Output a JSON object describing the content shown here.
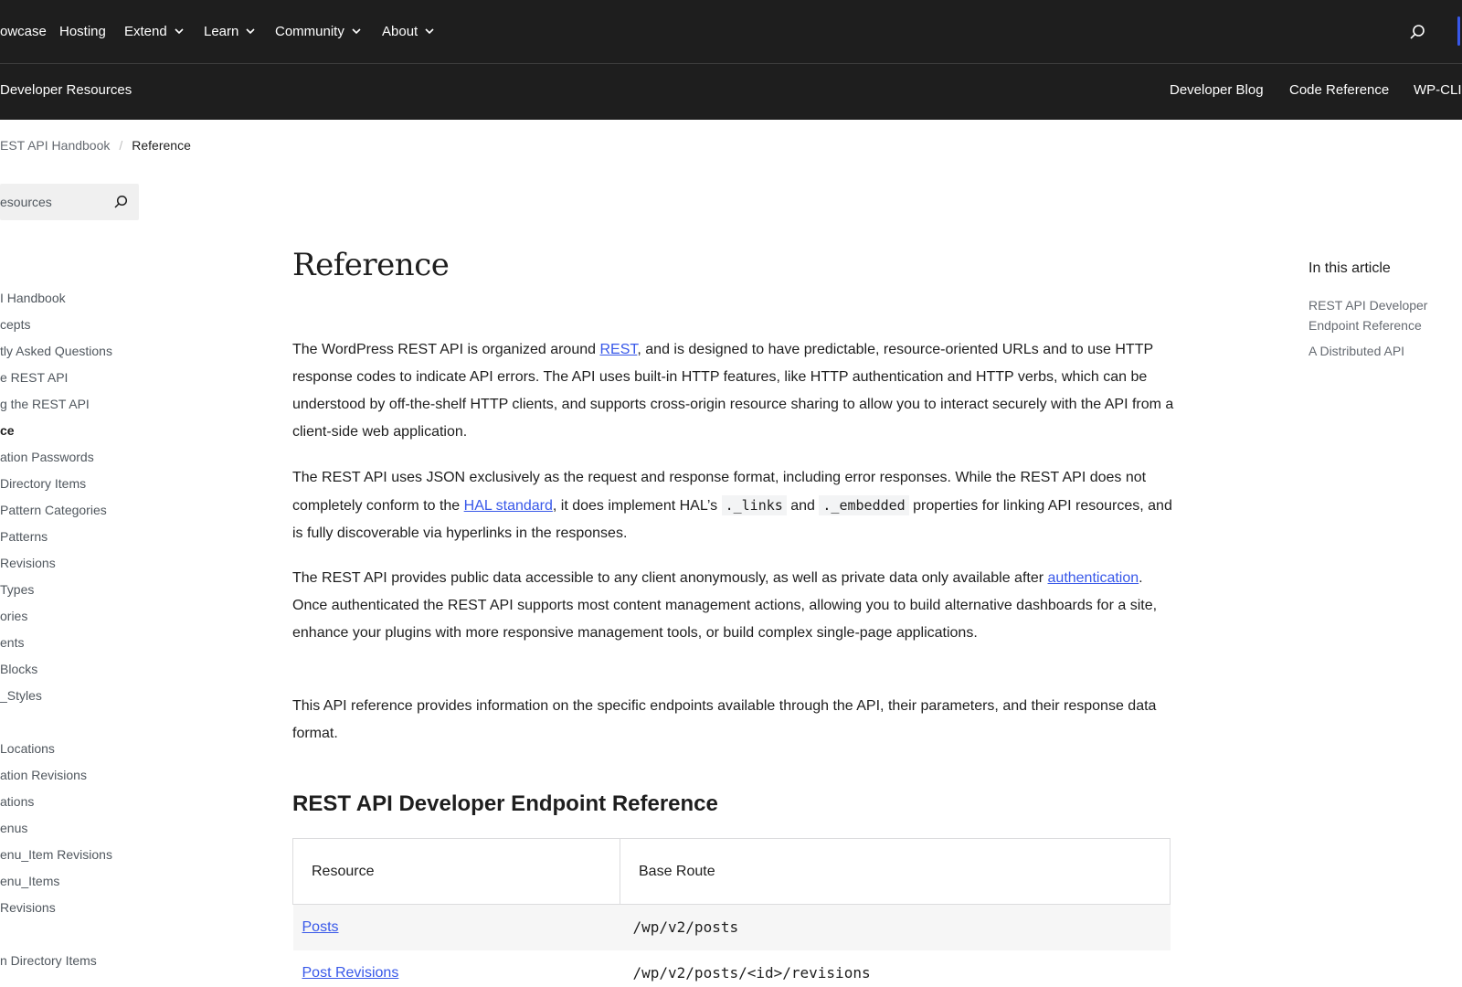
{
  "global_nav": {
    "items": [
      {
        "label": "owcase",
        "has_menu": false
      },
      {
        "label": "Hosting",
        "has_menu": false
      },
      {
        "label": "Extend",
        "has_menu": true
      },
      {
        "label": "Learn",
        "has_menu": true
      },
      {
        "label": "Community",
        "has_menu": true
      },
      {
        "label": "About",
        "has_menu": true
      }
    ]
  },
  "local_nav": {
    "title": "Developer Resources",
    "links": [
      "Developer Blog",
      "Code Reference",
      "WP-CLI"
    ]
  },
  "breadcrumb": {
    "parent": "EST API Handbook",
    "separator": "/",
    "current": "Reference"
  },
  "sidebar": {
    "search_placeholder": "esources",
    "items": [
      "I Handbook",
      "cepts",
      "tly Asked Questions",
      "e REST API",
      "g the REST API",
      "ce",
      "ation Passwords",
      "Directory Items",
      "Pattern Categories",
      "Patterns",
      "Revisions",
      "Types",
      "ories",
      "ents",
      "Blocks",
      "_Styles",
      "Locations",
      "ation Revisions",
      "ations",
      "enus",
      "enu_Item Revisions",
      "enu_Items",
      "Revisions",
      "n Directory Items"
    ]
  },
  "main": {
    "title": "Reference",
    "p1": {
      "before": "The WordPress REST API is organized around ",
      "link": "REST",
      "after": ", and is designed to have predictable, resource-oriented URLs and to use HTTP response codes to indicate API errors. The API uses built-in HTTP features, like HTTP authentication and HTTP verbs, which can be understood by off-the-shelf HTTP clients, and supports cross-origin resource sharing to allow you to interact securely with the API from a client-side web application."
    },
    "p2": {
      "before": "The REST API uses JSON exclusively as the request and response format, including error responses. While the REST API does not completely conform to the ",
      "link": "HAL standard",
      "middle": ", it does implement HAL’s ",
      "code1": "._links",
      "and": " and ",
      "code2": "._embedded",
      "after": " properties for linking API resources, and is fully discoverable via hyperlinks in the responses."
    },
    "p3": {
      "before": "The REST API provides public data accessible to any client anonymously, as well as private data only available after ",
      "link": "authentication",
      "after": ". Once authenticated the REST API supports most content management actions, allowing you to build alternative dashboards for a site, enhance your plugins with more responsive management tools, or build complex single-page applications."
    },
    "p4": "This API reference provides information on the specific endpoints available through the API, their parameters, and their response data format.",
    "section_title": "REST API Developer Endpoint Reference",
    "table": {
      "headers": [
        "Resource",
        "Base Route"
      ],
      "rows": [
        {
          "resource": "Posts",
          "route": "/wp/v2/posts"
        },
        {
          "resource": "Post Revisions",
          "route": "/wp/v2/posts/<id>/revisions"
        }
      ]
    }
  },
  "toc": {
    "title": "In this article",
    "links": [
      "REST API Developer Endpoint Reference",
      "A Distributed API"
    ]
  },
  "colors": {
    "header_bg": "#1e1e1e",
    "link": "#3858e9",
    "muted": "#50575e"
  },
  "icons": [
    "chevron-down-icon",
    "search-icon"
  ]
}
